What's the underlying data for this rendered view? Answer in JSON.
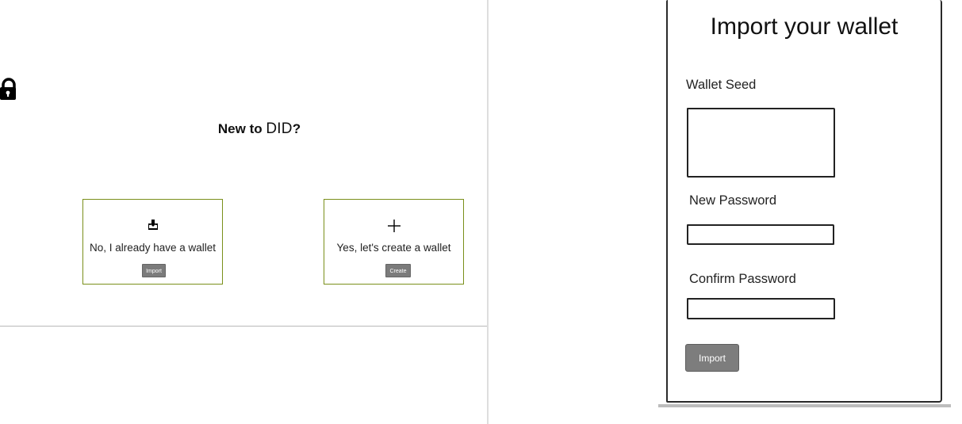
{
  "onboarding": {
    "heading_prefix": "New to",
    "heading_brand": "DID",
    "heading_suffix": "?",
    "import_card": {
      "icon": "inbox-download-icon",
      "label": "No, I already have a wallet",
      "button": "Import"
    },
    "create_card": {
      "icon": "plus-icon",
      "label": "Yes, let's create a wallet",
      "button": "Create"
    }
  },
  "import_panel": {
    "title": "Import your wallet",
    "seed_label": "Wallet Seed",
    "new_password_label": "New Password",
    "confirm_password_label": "Confirm Password",
    "submit_label": "Import"
  },
  "icons": {
    "lock": "lock-icon"
  },
  "colors": {
    "card_border": "#7a8f1a",
    "button": "#7b7b7b"
  }
}
